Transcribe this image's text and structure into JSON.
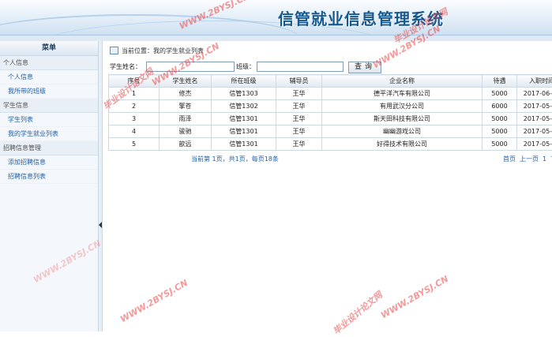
{
  "header": {
    "title": "信管就业信息管理系统"
  },
  "sidebar": {
    "title": "菜单",
    "groups": [
      {
        "label": "个人信息",
        "items": [
          "个人信息",
          "我所带的班级"
        ]
      },
      {
        "label": "学生信息",
        "items": [
          "学生列表",
          "我的学生就业列表"
        ]
      },
      {
        "label": "招聘信息管理",
        "items": [
          "添加招聘信息",
          "招聘信息列表"
        ]
      }
    ]
  },
  "breadcrumb": {
    "text": "当前位置：我的学生就业列表"
  },
  "search": {
    "name_label": "学生姓名：",
    "name_value": "",
    "class_label": "班级：",
    "class_value": "",
    "button": "查询"
  },
  "table": {
    "columns": [
      "序号",
      "学生姓名",
      "所在班级",
      "辅导员",
      "企业名称",
      "待遇",
      "入职时间"
    ],
    "rows": [
      [
        "1",
        "修杰",
        "信管1303",
        "王华",
        "德平洋汽车有限公司",
        "5000",
        "2017-06-28"
      ],
      [
        "2",
        "擎苍",
        "信管1302",
        "王华",
        "有用武汉分公司",
        "6000",
        "2017-05-31"
      ],
      [
        "3",
        "雨泽",
        "信管1301",
        "王华",
        "斯天田科技有限公司",
        "5000",
        "2017-05-19"
      ],
      [
        "4",
        "骏驰",
        "信管1301",
        "王华",
        "幽幽游戏公司",
        "5000",
        "2017-05-16"
      ],
      [
        "5",
        "歆远",
        "信管1301",
        "王华",
        "好得技术有限公司",
        "5000",
        "2017-05-12"
      ]
    ]
  },
  "pager": {
    "info": "当前第 1页，共1页，每页18条",
    "links": [
      "首页",
      "上一页",
      "1",
      "下"
    ]
  },
  "watermarks": [
    "WWW.2BYSJ.CN",
    "毕业设计论文网",
    "WWW.2BYSJ.CN",
    "WWW.2BYSJ.CN",
    "毕业设计论文网",
    "WWW.2BYSJ.CN",
    "WWW.2BYSJ.CN",
    "毕业设计论文网",
    "WWW.2BYSJ.CN"
  ],
  "colors": {
    "title": "#17598f",
    "link": "#1f5fa8",
    "watermark": "#eb4646"
  }
}
